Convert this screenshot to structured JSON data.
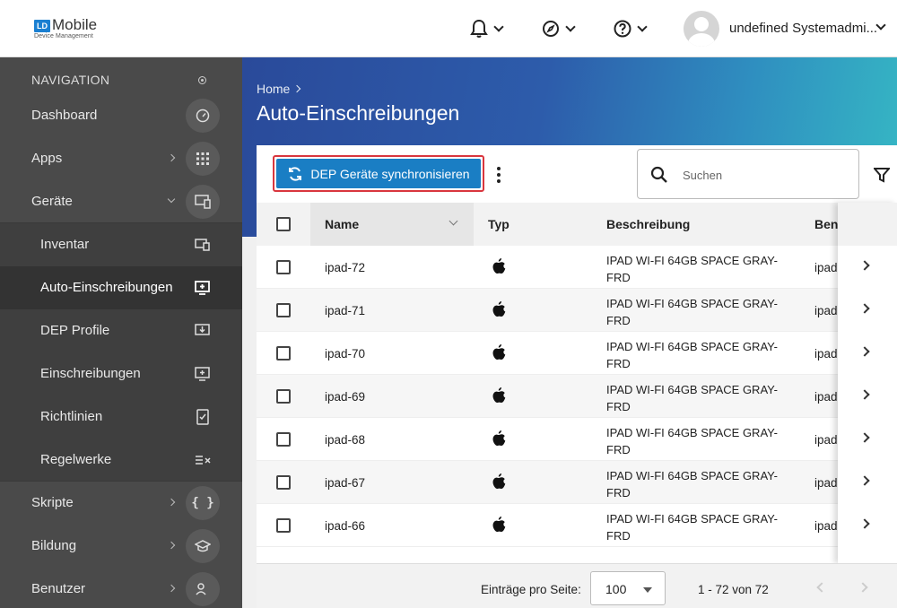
{
  "header": {
    "logo_mark": "LD",
    "logo_text": "Mobile",
    "logo_sub": "Device Management",
    "user_name": "undefined Systemadmi..."
  },
  "sidebar": {
    "heading": "NAVIGATION",
    "items": [
      {
        "label": "Dashboard",
        "icon": "speedometer-icon"
      },
      {
        "label": "Apps",
        "icon": "grid-icon"
      },
      {
        "label": "Geräte",
        "icon": "devices-icon"
      },
      {
        "label": "Inventar",
        "icon": "inventory-icon"
      },
      {
        "label": "Auto-Einschreibungen",
        "icon": "auto-enroll-icon"
      },
      {
        "label": "DEP Profile",
        "icon": "dep-profile-icon"
      },
      {
        "label": "Einschreibungen",
        "icon": "enroll-icon"
      },
      {
        "label": "Richtlinien",
        "icon": "policy-icon"
      },
      {
        "label": "Regelwerke",
        "icon": "rules-icon"
      },
      {
        "label": "Skripte",
        "icon": "braces-icon"
      },
      {
        "label": "Bildung",
        "icon": "graduation-icon"
      },
      {
        "label": "Benutzer",
        "icon": "users-icon"
      }
    ]
  },
  "breadcrumb": {
    "home": "Home"
  },
  "page_title": "Auto-Einschreibungen",
  "toolbar": {
    "sync_label": "DEP Geräte synchronisieren",
    "search_placeholder": "Suchen"
  },
  "table": {
    "columns": {
      "name": "Name",
      "typ": "Typ",
      "beschreibung": "Beschreibung",
      "benutzer": "Benu"
    },
    "rows": [
      {
        "name": "ipad-72",
        "desc": "IPAD WI-FI 64GB SPACE GRAY-FRD",
        "ben": "ipad"
      },
      {
        "name": "ipad-71",
        "desc": "IPAD WI-FI 64GB SPACE GRAY-FRD",
        "ben": "ipad"
      },
      {
        "name": "ipad-70",
        "desc": "IPAD WI-FI 64GB SPACE GRAY-FRD",
        "ben": "ipad"
      },
      {
        "name": "ipad-69",
        "desc": "IPAD WI-FI 64GB SPACE GRAY-FRD",
        "ben": "ipad"
      },
      {
        "name": "ipad-68",
        "desc": "IPAD WI-FI 64GB SPACE GRAY-FRD",
        "ben": "ipad"
      },
      {
        "name": "ipad-67",
        "desc": "IPAD WI-FI 64GB SPACE GRAY-FRD",
        "ben": "ipad"
      },
      {
        "name": "ipad-66",
        "desc": "IPAD WI-FI 64GB SPACE GRAY-FRD",
        "ben": "ipad"
      }
    ]
  },
  "footer": {
    "per_page_label": "Einträge pro Seite:",
    "per_page_value": "100",
    "range": "1 - 72 von 72"
  },
  "colors": {
    "primary_button": "#1a7ec4",
    "highlight_outline": "#d9363e",
    "sidebar_bg": "#4a4a4a"
  }
}
